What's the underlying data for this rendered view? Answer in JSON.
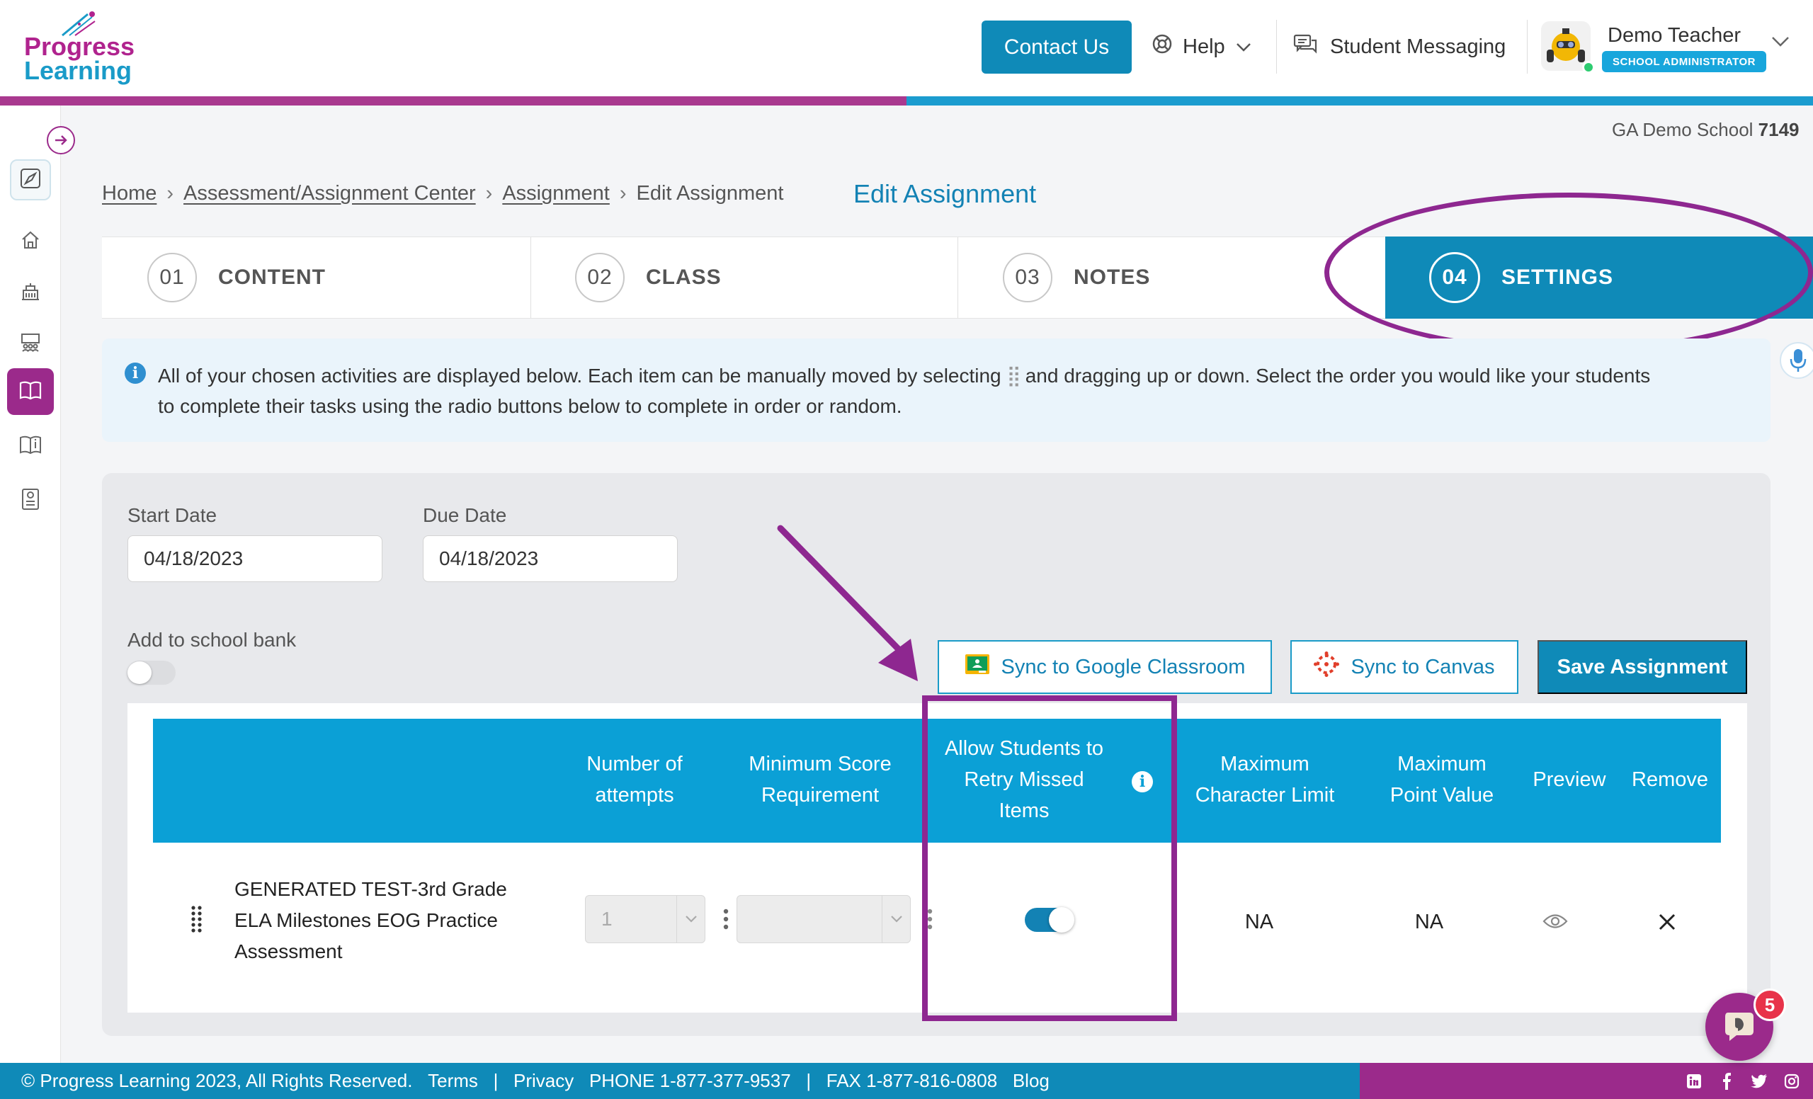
{
  "header": {
    "logo_line1": "Progress",
    "logo_line2": "Learning",
    "contact_label": "Contact Us",
    "help_label": "Help",
    "messaging_label": "Student Messaging",
    "user_name": "Demo Teacher",
    "user_role": "SCHOOL ADMINISTRATOR"
  },
  "school": {
    "name": "GA Demo School",
    "id": "7149"
  },
  "breadcrumb": [
    "Home",
    "Assessment/Assignment Center",
    "Assignment",
    "Edit Assignment"
  ],
  "page_title": "Edit Assignment",
  "steps": [
    {
      "num": "01",
      "label": "CONTENT"
    },
    {
      "num": "02",
      "label": "CLASS"
    },
    {
      "num": "03",
      "label": "NOTES"
    },
    {
      "num": "04",
      "label": "SETTINGS"
    }
  ],
  "info": {
    "line1_a": "All of your chosen activities are displayed below. Each item can be manually moved by selecting",
    "line1_b": "and dragging up or down. Select the order you would like your students",
    "line2": "to complete their tasks using the radio buttons below to complete in order or random."
  },
  "settings": {
    "start_label": "Start Date",
    "start_value": "04/18/2023",
    "due_label": "Due Date",
    "due_value": "04/18/2023",
    "school_bank_label": "Add to school bank",
    "school_bank_on": false,
    "google_label": "Sync to Google Classroom",
    "canvas_label": "Sync to Canvas",
    "save_label": "Save Assignment"
  },
  "table": {
    "headers": {
      "attempts": [
        "Number of",
        "attempts"
      ],
      "min_score": [
        "Minimum Score",
        "Requirement"
      ],
      "retry": [
        "Allow Students to",
        "Retry Missed",
        "Items"
      ],
      "max_char": [
        "Maximum",
        "Character Limit"
      ],
      "max_point": [
        "Maximum",
        "Point Value"
      ],
      "preview": "Preview",
      "remove": "Remove"
    },
    "rows": [
      {
        "title_lines": [
          "GENERATED TEST-3rd Grade",
          "ELA Milestones EOG Practice",
          "Assessment"
        ],
        "attempts": "1",
        "min_score": "",
        "retry_on": true,
        "max_char": "NA",
        "max_point": "NA"
      }
    ]
  },
  "footer": {
    "copyright": "© Progress Learning 2023, All Rights Reserved.",
    "terms": "Terms",
    "privacy": "Privacy",
    "phone": "PHONE 1-877-377-9537",
    "fax": "FAX 1-877-816-0808",
    "blog": "Blog"
  },
  "chat": {
    "badge_count": "5"
  },
  "colors": {
    "brand_purple": "#9b2a8b",
    "brand_blue": "#0f8ab8",
    "table_header": "#0ba0d6",
    "annotation": "#8e2790"
  }
}
